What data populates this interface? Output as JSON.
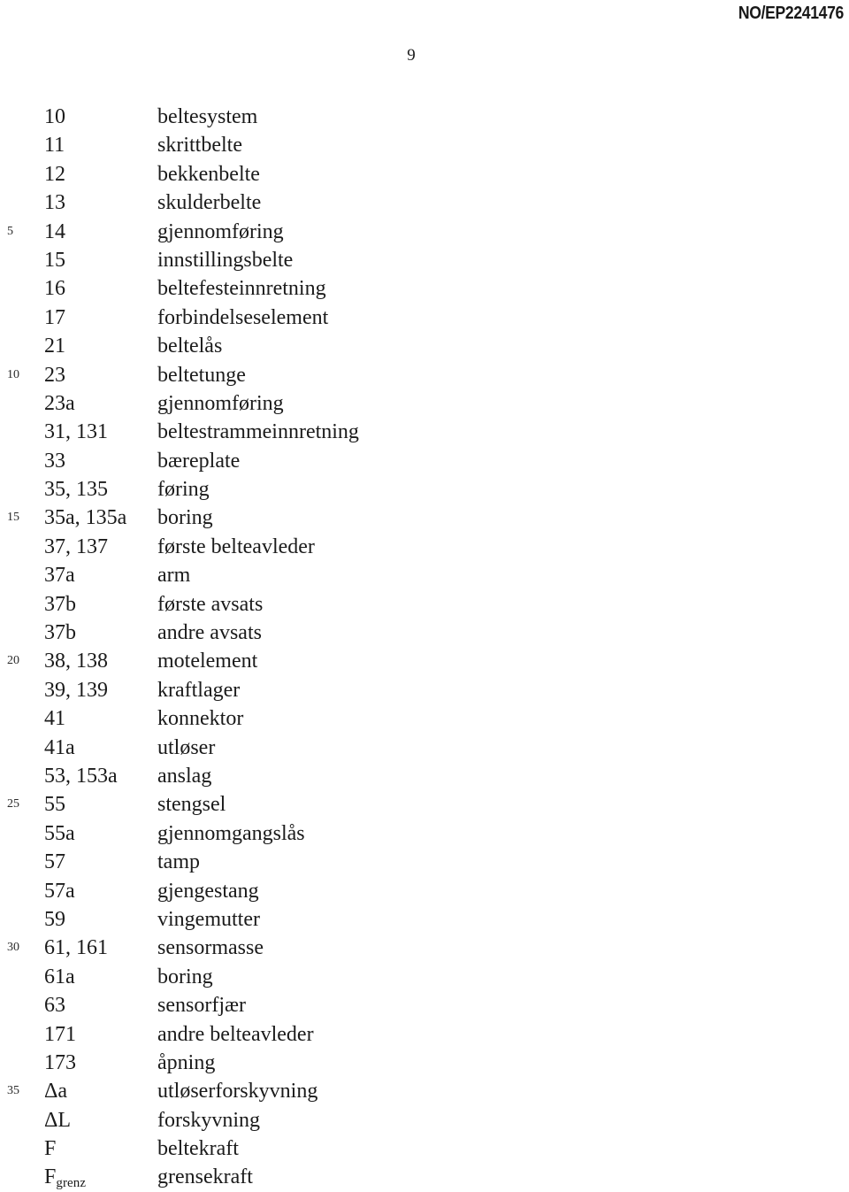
{
  "header": {
    "doc_id": "NO/EP2241476"
  },
  "page": {
    "number": "9"
  },
  "reference_list": {
    "rows": [
      {
        "marker": "",
        "numeral": "10",
        "description": "beltesystem"
      },
      {
        "marker": "",
        "numeral": "11",
        "description": "skrittbelte"
      },
      {
        "marker": "",
        "numeral": "12",
        "description": "bekkenbelte"
      },
      {
        "marker": "",
        "numeral": "13",
        "description": "skulderbelte"
      },
      {
        "marker": "5",
        "numeral": "14",
        "description": "gjennomføring"
      },
      {
        "marker": "",
        "numeral": "15",
        "description": "innstillingsbelte"
      },
      {
        "marker": "",
        "numeral": "16",
        "description": "beltefesteinnretning"
      },
      {
        "marker": "",
        "numeral": "17",
        "description": "forbindelseselement"
      },
      {
        "marker": "",
        "numeral": "21",
        "description": "beltelås"
      },
      {
        "marker": "10",
        "numeral": "23",
        "description": "beltetunge"
      },
      {
        "marker": "",
        "numeral": "23a",
        "description": "gjennomføring"
      },
      {
        "marker": "",
        "numeral": "31, 131",
        "description": "beltestrammeinnretning"
      },
      {
        "marker": "",
        "numeral": "33",
        "description": "bæreplate"
      },
      {
        "marker": "",
        "numeral": "35, 135",
        "description": "føring"
      },
      {
        "marker": "15",
        "numeral": "35a, 135a",
        "description": "boring"
      },
      {
        "marker": "",
        "numeral": "37, 137",
        "description": "første belteavleder"
      },
      {
        "marker": "",
        "numeral": "37a",
        "description": "arm"
      },
      {
        "marker": "",
        "numeral": "37b",
        "description": "første avsats"
      },
      {
        "marker": "",
        "numeral": "37b",
        "description": "andre avsats"
      },
      {
        "marker": "20",
        "numeral": "38, 138",
        "description": "motelement"
      },
      {
        "marker": "",
        "numeral": "39, 139",
        "description": "kraftlager"
      },
      {
        "marker": "",
        "numeral": "41",
        "description": "konnektor"
      },
      {
        "marker": "",
        "numeral": "41a",
        "description": "utløser"
      },
      {
        "marker": "",
        "numeral": "53, 153a",
        "description": "anslag"
      },
      {
        "marker": "25",
        "numeral": "55",
        "description": "stengsel"
      },
      {
        "marker": "",
        "numeral": "55a",
        "description": "gjennomgangslås"
      },
      {
        "marker": "",
        "numeral": "57",
        "description": "tamp"
      },
      {
        "marker": "",
        "numeral": "57a",
        "description": "gjengestang"
      },
      {
        "marker": "",
        "numeral": "59",
        "description": "vingemutter"
      },
      {
        "marker": "30",
        "numeral": "61, 161",
        "description": "sensormasse"
      },
      {
        "marker": "",
        "numeral": "61a",
        "description": "boring"
      },
      {
        "marker": "",
        "numeral": "63",
        "description": "sensorfjær"
      },
      {
        "marker": "",
        "numeral": "171",
        "description": "andre belteavleder"
      },
      {
        "marker": "",
        "numeral": "173",
        "description": "åpning"
      },
      {
        "marker": "35",
        "numeral": "Δa",
        "description": "utløserforskyvning"
      },
      {
        "marker": "",
        "numeral": "ΔL",
        "description": "forskyvning"
      },
      {
        "marker": "",
        "numeral": "F",
        "description": "beltekraft"
      },
      {
        "marker": "",
        "numeral": "F",
        "numeral_subscript": "grenz",
        "description": "grensekraft"
      }
    ]
  }
}
